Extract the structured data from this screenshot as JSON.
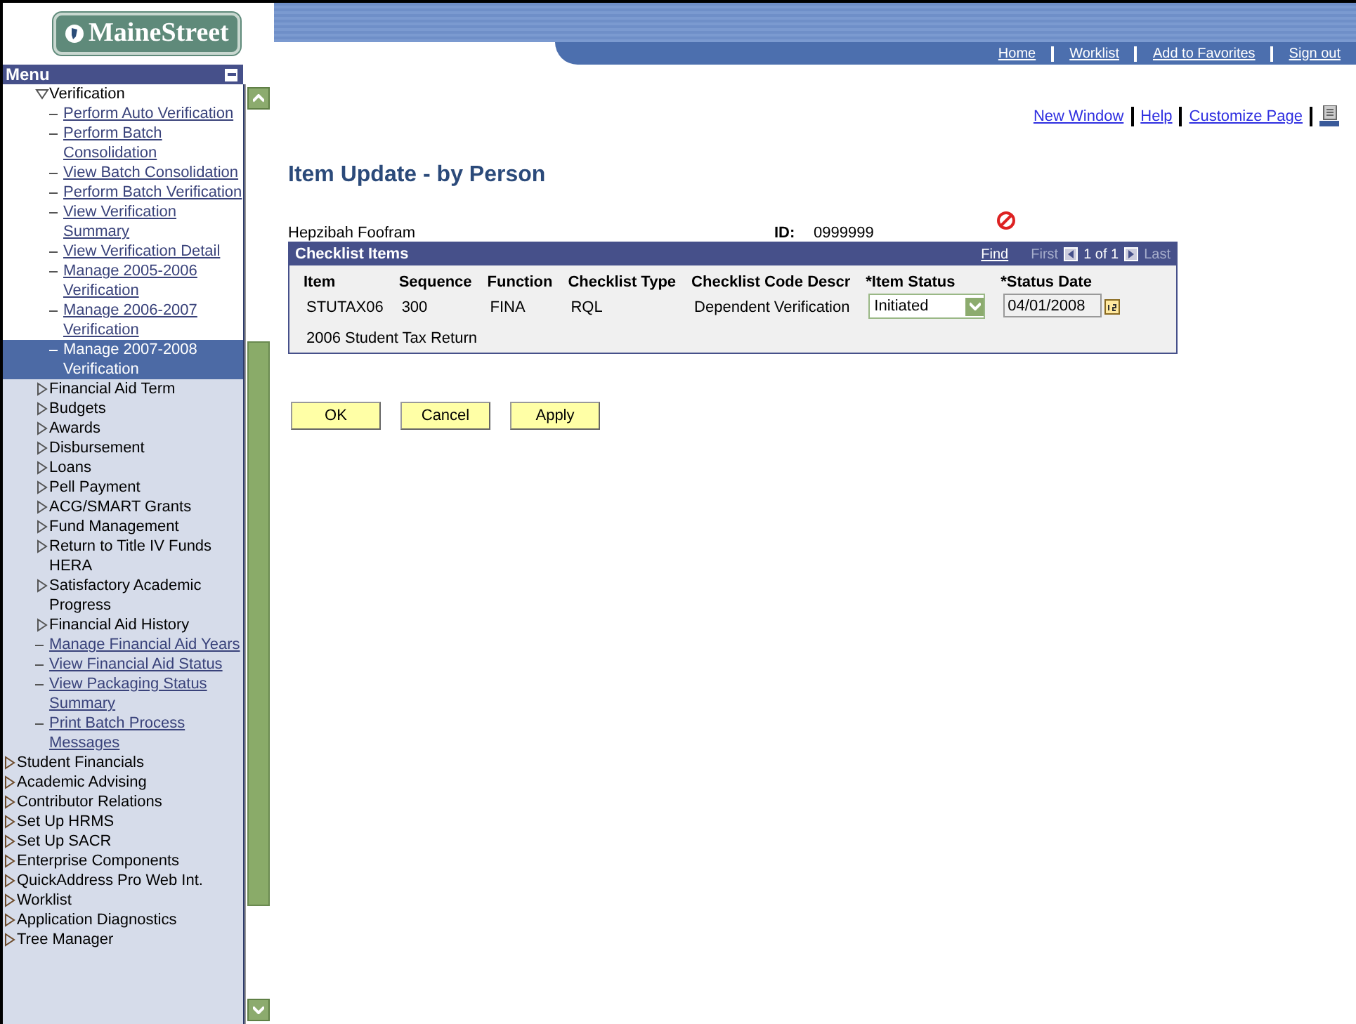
{
  "logo": {
    "text": "MaineStreet"
  },
  "menu": {
    "title": "Menu",
    "group": [
      {
        "kind": "folder",
        "label": "Verification",
        "expanded": true,
        "children": [
          {
            "kind": "link",
            "label": "Perform Auto Verification",
            "selected": false
          },
          {
            "kind": "link",
            "label": "Perform Batch Consolidation",
            "selected": false
          },
          {
            "kind": "link",
            "label": "View Batch Consolidation",
            "selected": false
          },
          {
            "kind": "link",
            "label": "Perform Batch Verification",
            "selected": false
          },
          {
            "kind": "link",
            "label": "View Verification Summary",
            "selected": false
          },
          {
            "kind": "link",
            "label": "View Verification Detail",
            "selected": false
          },
          {
            "kind": "link",
            "label": "Manage 2005-2006 Verification",
            "selected": false
          },
          {
            "kind": "link",
            "label": "Manage 2006-2007 Verification",
            "selected": false
          },
          {
            "kind": "link",
            "label": "Manage 2007-2008 Verification",
            "selected": true
          }
        ]
      },
      {
        "kind": "folder",
        "label": "Financial Aid Term",
        "expanded": false
      },
      {
        "kind": "folder",
        "label": "Budgets",
        "expanded": false
      },
      {
        "kind": "folder",
        "label": "Awards",
        "expanded": false
      },
      {
        "kind": "folder",
        "label": "Disbursement",
        "expanded": false
      },
      {
        "kind": "folder",
        "label": "Loans",
        "expanded": false
      },
      {
        "kind": "folder",
        "label": "Pell Payment",
        "expanded": false
      },
      {
        "kind": "folder",
        "label": "ACG/SMART Grants",
        "expanded": false
      },
      {
        "kind": "folder",
        "label": "Fund Management",
        "expanded": false
      },
      {
        "kind": "folder",
        "label": "Return to Title IV Funds HERA",
        "expanded": false
      },
      {
        "kind": "folder",
        "label": "Satisfactory Academic Progress",
        "expanded": false
      },
      {
        "kind": "folder",
        "label": "Financial Aid History",
        "expanded": false
      },
      {
        "kind": "link",
        "label": "Manage Financial Aid Years",
        "selected": false
      },
      {
        "kind": "link",
        "label": "View Financial Aid Status",
        "selected": false
      },
      {
        "kind": "link",
        "label": "View Packaging Status Summary",
        "selected": false
      },
      {
        "kind": "link",
        "label": "Print Batch Process Messages",
        "selected": false
      }
    ],
    "items": [
      {
        "kind": "folder",
        "label": "Student Financials",
        "expanded": false
      },
      {
        "kind": "folder",
        "label": "Academic Advising",
        "expanded": false
      },
      {
        "kind": "folder",
        "label": "Contributor Relations",
        "expanded": false
      },
      {
        "kind": "folder",
        "label": "Set Up HRMS",
        "expanded": false
      },
      {
        "kind": "folder",
        "label": "Set Up SACR",
        "expanded": false
      },
      {
        "kind": "folder",
        "label": "Enterprise Components",
        "expanded": false
      },
      {
        "kind": "folder",
        "label": "QuickAddress Pro Web Int.",
        "expanded": false
      },
      {
        "kind": "folder",
        "label": "Worklist",
        "expanded": false
      },
      {
        "kind": "folder",
        "label": "Application Diagnostics",
        "expanded": false
      },
      {
        "kind": "folder",
        "label": "Tree Manager",
        "expanded": false
      }
    ]
  },
  "nav": [
    "Home",
    "Worklist",
    "Add to Favorites",
    "Sign out"
  ],
  "page_links": [
    "New Window",
    "Help",
    "Customize Page"
  ],
  "page_title": "Item Update - by Person",
  "person": {
    "name": "Hepzibah Foofram",
    "id_label": "ID:",
    "id": "0999999"
  },
  "checklist": {
    "title": "Checklist Items",
    "find": "Find",
    "first": "First",
    "count": "1 of 1",
    "last": "Last",
    "columns": [
      "Item",
      "Sequence",
      "Function",
      "Checklist Type",
      "Checklist Code Descr",
      "*Item Status",
      "*Status Date"
    ],
    "row": {
      "item": "STUTAX06",
      "sequence": "300",
      "function": "FINA",
      "type": "RQL",
      "descr": "Dependent Verification",
      "status": "Initiated",
      "date": "04/01/2008",
      "long_descr": "2006 Student Tax Return"
    }
  },
  "buttons": [
    "OK",
    "Cancel",
    "Apply"
  ]
}
